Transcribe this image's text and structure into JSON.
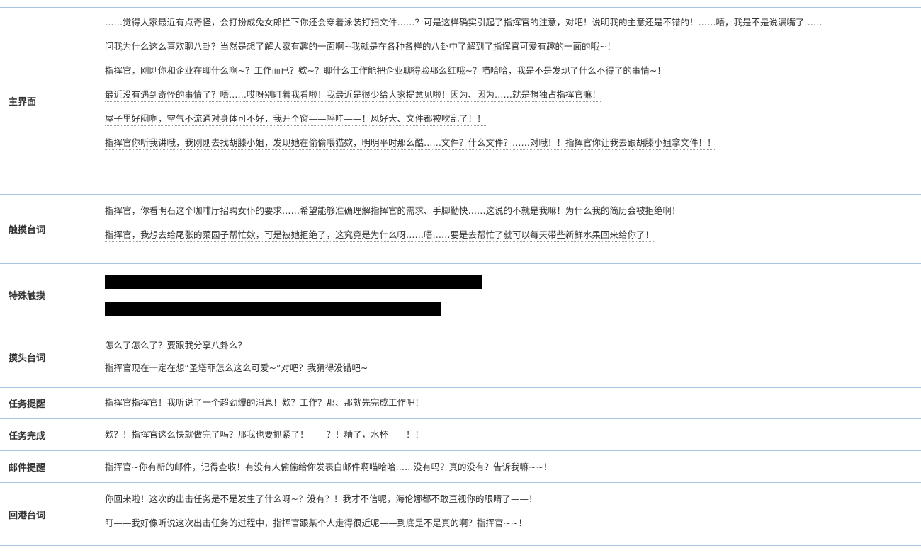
{
  "rows": [
    {
      "label": "主界面",
      "lines": [
        "……觉得大家最近有点奇怪，会打扮成兔女郎拦下你还会穿着泳装打扫文件……？可是这样确实引起了指挥官的注意，对吧！说明我的主意还是不错的！……唔，我是不是说漏嘴了……",
        "问我为什么这么喜欢聊八卦？当然是想了解大家有趣的一面啊~我就是在各种各样的八卦中了解到了指挥官可爱有趣的一面的哦~！",
        "指挥官，刚刚你和企业在聊什么啊~？工作而已？欸~？聊什么工作能把企业聊得脸那么红哦~？喵哈哈，我是不是发现了什么不得了的事情~！",
        "最近没有遇到奇怪的事情了？唔……哎呀别盯着我看啦！我最近是很少给大家提意见啦！因为、因为……就是想独占指挥官嘛！",
        "屋子里好闷啊，空气不流通对身体可不好，我开个窗——呼哇——！风好大、文件都被吹乱了！！",
        "指挥官你听我讲哦，我刚刚去找胡滕小姐，发现她在偷偷喂猫欸，明明平时那么酷……文件？什么文件？……对哦！！指挥官你让我去跟胡滕小姐拿文件！！"
      ]
    },
    {
      "label": "触摸台词",
      "lines": [
        "指挥官，你看明石这个咖啡厅招聘女仆的要求……希望能够准确理解指挥官的需求、手脚勤快……这说的不就是我嘛！为什么我的简历会被拒绝啊！",
        "指挥官，我想去给尾张的菜园子帮忙欸，可是被她拒绝了，这究竟是为什么呀……唔……要是去帮忙了就可以每天带些新鲜水果回来给你了！"
      ]
    },
    {
      "label": "特殊触摸",
      "lines": []
    },
    {
      "label": "摸头台词",
      "lines": [
        "怎么了怎么了？要跟我分享八卦么？",
        "指挥官现在一定在想“圣塔菲怎么这么可爱~”对吧？我猜得没错吧~"
      ]
    },
    {
      "label": "任务提醒",
      "lines": [
        "指挥官指挥官！我听说了一个超劲爆的消息！欸？工作？那、那就先完成工作吧！"
      ]
    },
    {
      "label": "任务完成",
      "lines": [
        "欸？！指挥官这么快就做完了吗？那我也要抓紧了！——？！糟了，水杯——！！"
      ]
    },
    {
      "label": "邮件提醒",
      "lines": [
        "指挥官~你有新的邮件，记得查收！有没有人偷偷给你发表白邮件啊喵哈哈……没有吗？真的没有？告诉我嘛~~！"
      ]
    },
    {
      "label": "回港台词",
      "lines": [
        "你回来啦！这次的出击任务是不是发生了什么呀~？没有？！我才不信呢，海伦娜都不敢直视你的眼睛了——！",
        "盯——我好像听说这次出击任务的过程中，指挥官跟某个人走得很近呢——到底是不是真的啊？指挥官~~！"
      ]
    }
  ]
}
